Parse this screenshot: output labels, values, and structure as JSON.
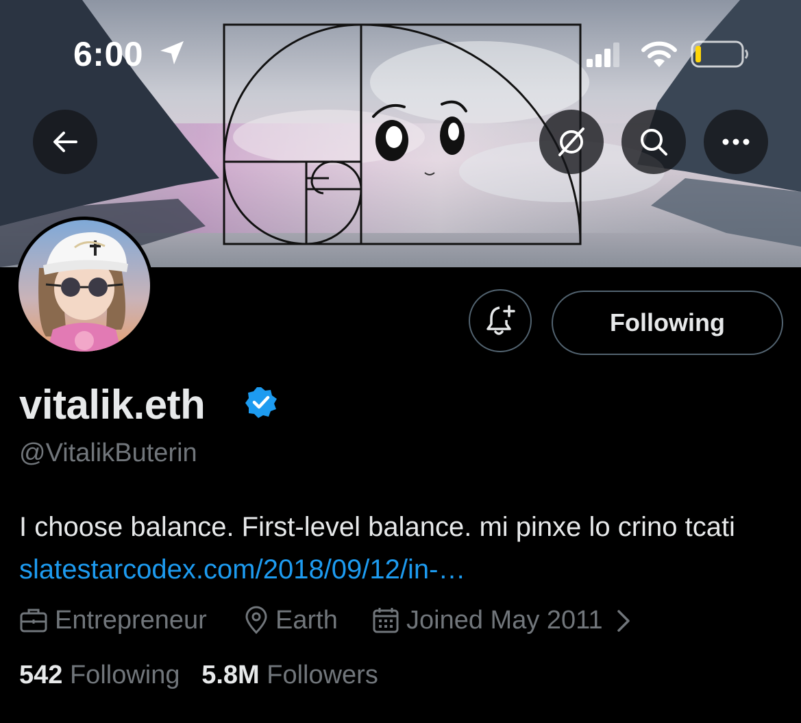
{
  "status_bar": {
    "time": "6:00",
    "icons": [
      "location-arrow-icon",
      "cellular-signal-icon",
      "wifi-icon",
      "battery-icon"
    ]
  },
  "header_buttons": [
    "back-arrow-icon",
    "grok-icon",
    "search-icon",
    "more-icon"
  ],
  "profile": {
    "display_name": "vitalik.eth",
    "verified_badge_color": "#1d9bf0",
    "handle": "@VitalikButerin",
    "bio_text": "I choose balance. First-level balance. mi pinxe lo crino tcati ",
    "bio_link": "slatestarcodex.com/2018/09/12/in-…",
    "profession": "Entrepreneur",
    "location": "Earth",
    "joined": "Joined May 2011",
    "following_count": "542",
    "following_label": "Following",
    "followers_count": "5.8M",
    "followers_label": "Followers"
  },
  "actions": {
    "following_button_label": "Following"
  },
  "colors": {
    "background": "#000000",
    "primary_text": "#e7e9ea",
    "secondary_text": "#71767b",
    "link": "#1d9bf0",
    "button_border": "#536471"
  }
}
